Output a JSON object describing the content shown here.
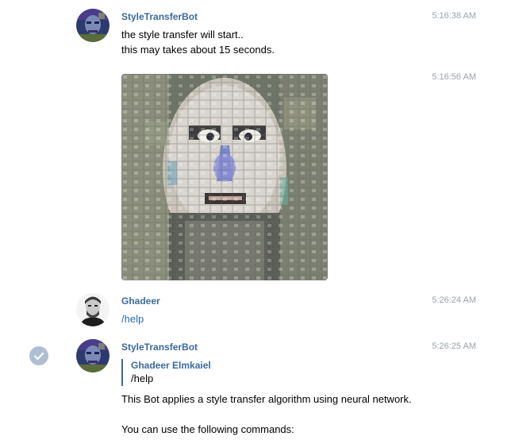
{
  "messages": [
    {
      "author": "StyleTransferBot",
      "time": "5:16:38 AM",
      "lines": [
        "the style transfer will start..",
        "this may takes about 15 seconds."
      ]
    },
    {
      "time": "5:16:56 AM",
      "photo_icon": "stylized-portrait-image"
    },
    {
      "author": "Ghadeer",
      "time": "5:26:24 AM",
      "text": "/help"
    },
    {
      "author": "StyleTransferBot",
      "time": "5:26:25 AM",
      "reply_author": "Ghadeer Elmkaiel",
      "reply_text": "/help",
      "lines": [
        "This Bot applies a style transfer algorithm using neural network.",
        "You can use the following commands:"
      ]
    }
  ],
  "colors": {
    "author": "#3a6a9e",
    "timestamp": "#9aa3ab",
    "link": "#2a6eb8",
    "selection_check": "#aebfd3"
  }
}
